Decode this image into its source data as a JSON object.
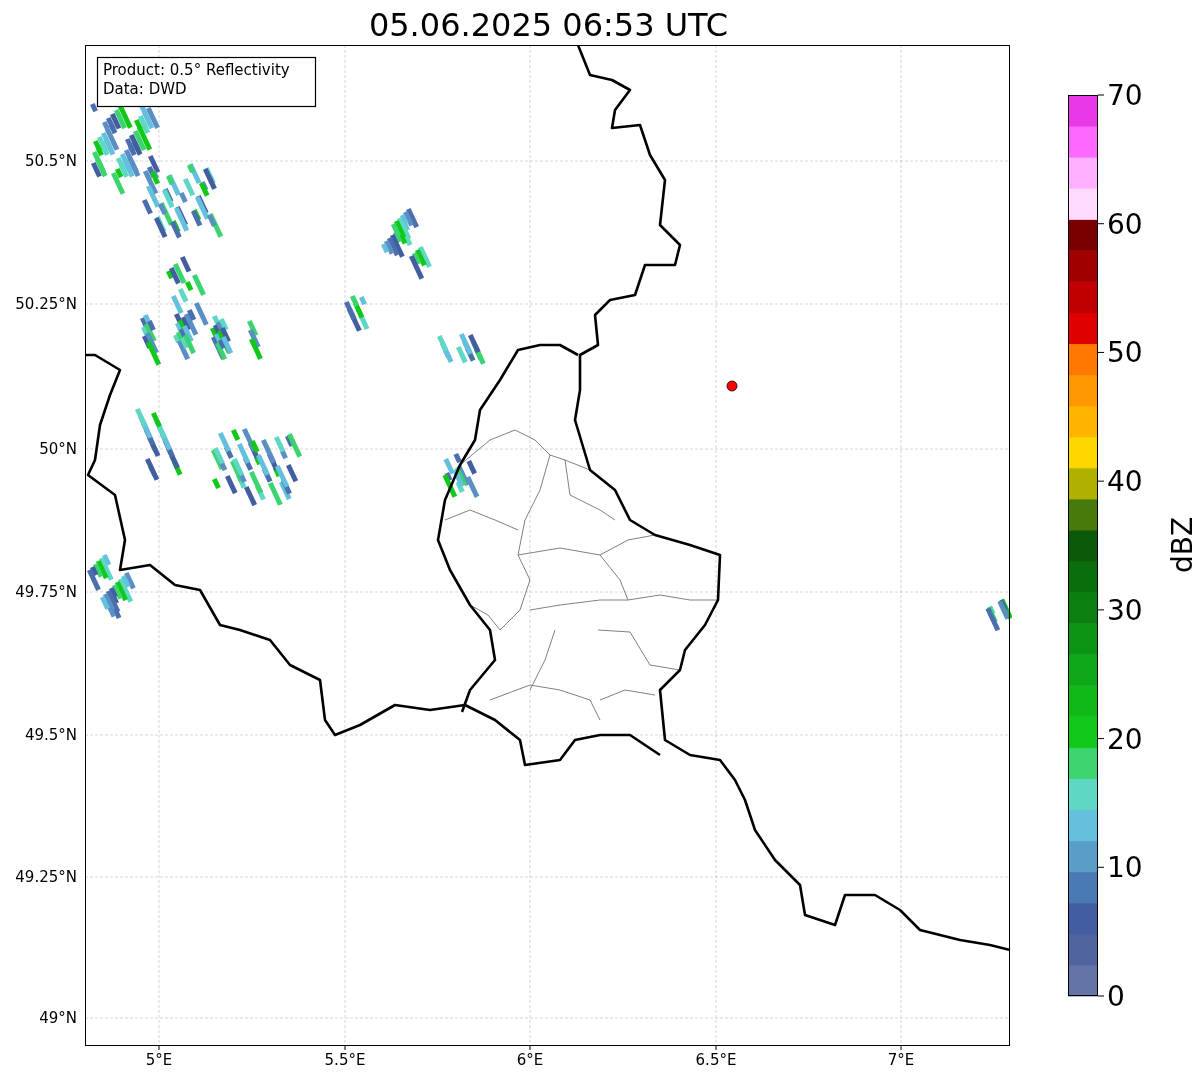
{
  "title": "05.06.2025 06:53 UTC",
  "legend_box": {
    "lines": [
      "Product: 0.5° Reflectivity",
      "Data: DWD"
    ]
  },
  "map": {
    "latitude_labels": [
      "50.5°N",
      "50.25°N",
      "50°N",
      "49.75°N",
      "49.5°N",
      "49.25°N",
      "49°N"
    ],
    "longitude_labels": [
      "5°E",
      "5.5°E",
      "6°E",
      "6.5°E",
      "7°E"
    ]
  },
  "colorbar": {
    "label": "dBZ",
    "ticks": [
      "70",
      "60",
      "50",
      "40",
      "30",
      "20",
      "10",
      "0"
    ],
    "segments": [
      {
        "color": "#6474a4"
      },
      {
        "color": "#5065a0"
      },
      {
        "color": "#435ea0"
      },
      {
        "color": "#4a7ab4"
      },
      {
        "color": "#5a9ec8"
      },
      {
        "color": "#64c0dc"
      },
      {
        "color": "#5ed8c4"
      },
      {
        "color": "#3cd46e"
      },
      {
        "color": "#10c818"
      },
      {
        "color": "#10b818"
      },
      {
        "color": "#0ea818"
      },
      {
        "color": "#0c9414"
      },
      {
        "color": "#0a8010"
      },
      {
        "color": "#0a6e0c"
      },
      {
        "color": "#0a5a0a"
      },
      {
        "color": "#467a0a"
      },
      {
        "color": "#b0b000"
      },
      {
        "color": "#ffd700"
      },
      {
        "color": "#ffb400"
      },
      {
        "color": "#ff9800"
      },
      {
        "color": "#ff7800"
      },
      {
        "color": "#e00000"
      },
      {
        "color": "#c00000"
      },
      {
        "color": "#a00000"
      },
      {
        "color": "#7a0000"
      },
      {
        "color": "#ffdcff"
      },
      {
        "color": "#ffb0ff"
      },
      {
        "color": "#ff68ff"
      },
      {
        "color": "#e838e8"
      }
    ]
  }
}
